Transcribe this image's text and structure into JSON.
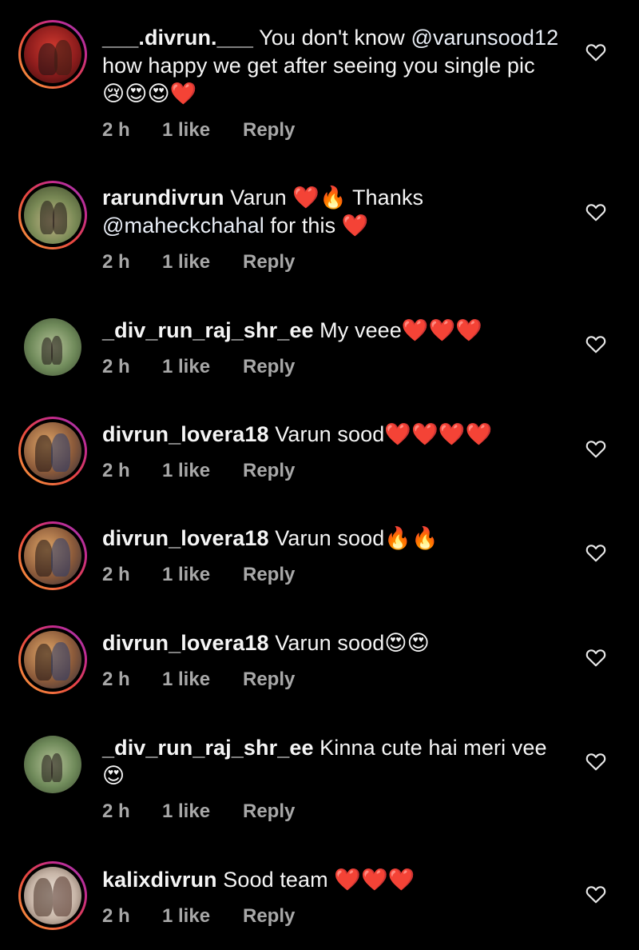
{
  "colors": {
    "background": "#000000",
    "text": "#f5f5f5",
    "meta": "#a8a8a8",
    "story_ring": [
      "#f9a23c",
      "#e8473f",
      "#c32a8d",
      "#9b3fb8"
    ]
  },
  "comments": [
    {
      "username": "___.divrun.___",
      "text_parts": [
        "You don't know ",
        "@varunsood12",
        " how happy we get after seeing you single pic "
      ],
      "emojis": "😢😍😍❤️",
      "time": "2 h",
      "likes": "1 like",
      "reply": "Reply",
      "has_story_ring": true,
      "avatar_icon": "avatar-couple-red"
    },
    {
      "username": "rarundivrun",
      "text_parts": [
        "Varun ",
        "❤️🔥",
        " Thanks ",
        "@maheckchahal",
        " for this "
      ],
      "emojis": "❤️",
      "time": "2 h",
      "likes": "1 like",
      "reply": "Reply",
      "has_story_ring": true,
      "avatar_icon": "avatar-couple-outdoor"
    },
    {
      "username": "_div_run_raj_shr_ee",
      "text": "My veee",
      "emojis": "❤️❤️❤️",
      "time": "2 h",
      "likes": "1 like",
      "reply": "Reply",
      "has_story_ring": false,
      "avatar_icon": "avatar-couple-green"
    },
    {
      "username": "divrun_lovera18",
      "text": "Varun sood",
      "emojis": "❤️❤️❤️❤️",
      "time": "2 h",
      "likes": "1 like",
      "reply": "Reply",
      "has_story_ring": true,
      "avatar_icon": "avatar-couple-sunset"
    },
    {
      "username": "divrun_lovera18",
      "text": "Varun sood",
      "emojis": "🔥🔥",
      "time": "2 h",
      "likes": "1 like",
      "reply": "Reply",
      "has_story_ring": true,
      "avatar_icon": "avatar-couple-sunset"
    },
    {
      "username": "divrun_lovera18",
      "text": "Varun sood",
      "emojis": "😍😍",
      "time": "2 h",
      "likes": "1 like",
      "reply": "Reply",
      "has_story_ring": true,
      "avatar_icon": "avatar-couple-sunset"
    },
    {
      "username": "_div_run_raj_shr_ee",
      "text": "Kinna cute hai meri vee",
      "emojis": "😍",
      "time": "2 h",
      "likes": "1 like",
      "reply": "Reply",
      "has_story_ring": false,
      "avatar_icon": "avatar-couple-green"
    },
    {
      "username": "kalixdivrun",
      "text": "Sood team",
      "emojis": "❤️❤️❤️",
      "time": "2 h",
      "likes": "1 like",
      "reply": "Reply",
      "has_story_ring": true,
      "avatar_icon": "avatar-couple-light"
    }
  ]
}
